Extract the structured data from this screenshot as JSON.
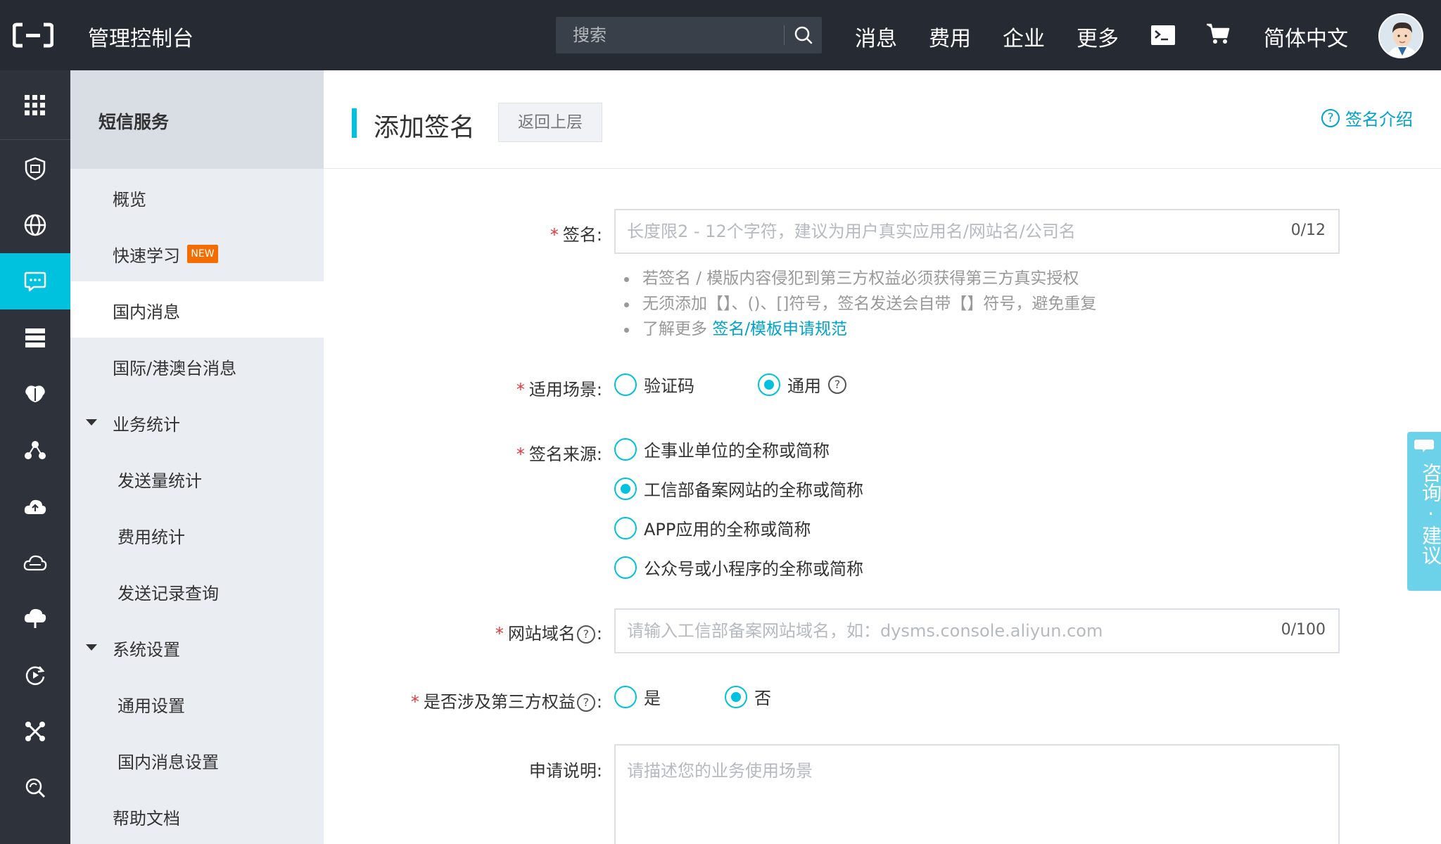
{
  "topbar": {
    "title": "管理控制台",
    "search_placeholder": "搜索",
    "nav": [
      "消息",
      "费用",
      "企业",
      "更多"
    ],
    "language": "简体中文"
  },
  "sidebar": {
    "header": "短信服务",
    "items": [
      {
        "label": "概览"
      },
      {
        "label": "快速学习",
        "badge": "NEW"
      },
      {
        "label": "国内消息",
        "selected": true
      },
      {
        "label": "国际/港澳台消息"
      },
      {
        "label": "业务统计",
        "expanded": true
      },
      {
        "label": "发送量统计"
      },
      {
        "label": "费用统计"
      },
      {
        "label": "发送记录查询"
      },
      {
        "label": "系统设置",
        "expanded": true
      },
      {
        "label": "通用设置"
      },
      {
        "label": "国内消息设置"
      },
      {
        "label": "帮助文档"
      }
    ]
  },
  "page": {
    "title": "添加签名",
    "back_label": "返回上层",
    "help_label": "签名介绍"
  },
  "form": {
    "signature": {
      "label": "签名:",
      "placeholder": "长度限2 - 12个字符，建议为用户真实应用名/网站名/公司名",
      "counter": "0/12"
    },
    "hints": [
      "若签名 / 模版内容侵犯到第三方权益必须获得第三方真实授权",
      "无须添加【】、()、[]符号，签名发送会自带【】符号，避免重复"
    ],
    "hint_more_prefix": "了解更多 ",
    "hint_more_link": "签名/模板申请规范",
    "scene": {
      "label": "适用场景:",
      "options": [
        "验证码",
        "通用"
      ],
      "selected": "通用"
    },
    "source": {
      "label": "签名来源:",
      "options": [
        "企事业单位的全称或简称",
        "工信部备案网站的全称或简称",
        "APP应用的全称或简称",
        "公众号或小程序的全称或简称"
      ],
      "selected": "工信部备案网站的全称或简称"
    },
    "domain": {
      "label": "网站域名",
      "placeholder": "请输入工信部备案网站域名，如：dysms.console.aliyun.com",
      "counter": "0/100"
    },
    "third_party": {
      "label": "是否涉及第三方权益",
      "options": [
        "是",
        "否"
      ],
      "selected": "否"
    },
    "description": {
      "label": "申请说明:",
      "placeholder": "请描述您的业务使用场景"
    }
  },
  "feedback": {
    "label": "咨询·建议"
  },
  "colors": {
    "accent": "#00c1de",
    "link": "#00a2ca",
    "topbar_bg": "#262b33",
    "required": "#e4393c"
  }
}
